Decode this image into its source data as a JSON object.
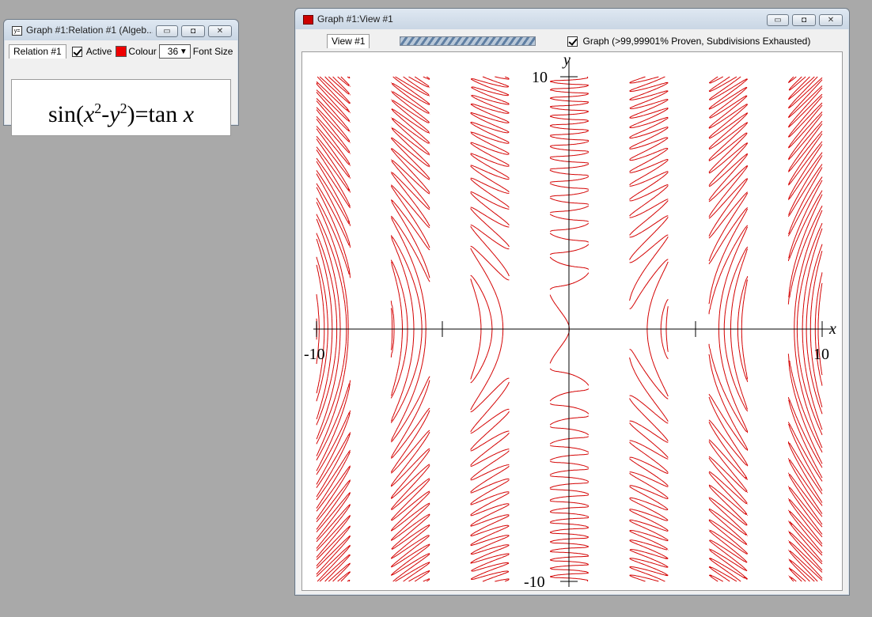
{
  "relation_window": {
    "title": "Graph #1:Relation #1 (Algeb...",
    "tab_label": "Relation #1",
    "active_label": "Active",
    "active_checked": true,
    "colour_label": "Colour",
    "colour_value": "#ee0000",
    "font_size_value": "36",
    "font_size_label": "Font Size",
    "formula": {
      "fn": "sin",
      "x": "x",
      "sup2": "2",
      "minus": "-",
      "y": "y",
      "eq": "=tan"
    }
  },
  "view_window": {
    "title": "Graph #1:View #1",
    "tab_label": "View #1",
    "graph_checked": true,
    "graph_status": "Graph (>99,99901% Proven, Subdivisions Exhausted)"
  },
  "chart_data": {
    "type": "implicit-curve",
    "relation": "sin(x^2-y^2)=tan x",
    "x_range": [
      -10,
      10
    ],
    "y_range": [
      -10,
      10
    ],
    "x_axis_label": "x",
    "y_axis_label": "y",
    "tick_labels": {
      "x_min": "-10",
      "x_max": "10",
      "y_min": "-10",
      "y_max": "10"
    },
    "curve_color": "#d40000",
    "grid": false
  }
}
